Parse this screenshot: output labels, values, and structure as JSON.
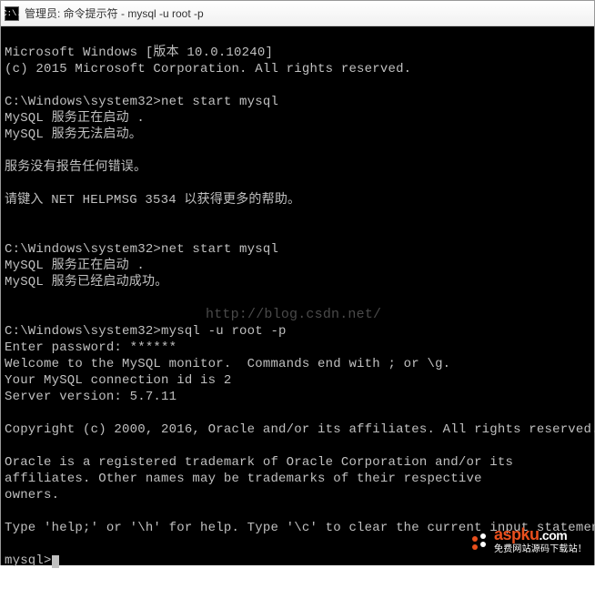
{
  "titlebar": {
    "icon_label": "C:\\.",
    "title": "管理员: 命令提示符 - mysql  -u root -p"
  },
  "terminal": {
    "l01": "Microsoft Windows [版本 10.0.10240]",
    "l02": "(c) 2015 Microsoft Corporation. All rights reserved.",
    "l03": "",
    "l04": "C:\\Windows\\system32>net start mysql",
    "l05": "MySQL 服务正在启动 .",
    "l06": "MySQL 服务无法启动。",
    "l07": "",
    "l08": "服务没有报告任何错误。",
    "l09": "",
    "l10": "请键入 NET HELPMSG 3534 以获得更多的帮助。",
    "l11": "",
    "l12": "",
    "l13": "C:\\Windows\\system32>net start mysql",
    "l14": "MySQL 服务正在启动 .",
    "l15": "MySQL 服务已经启动成功。",
    "l16": "",
    "l17": "",
    "l18": "C:\\Windows\\system32>mysql -u root -p",
    "l19": "Enter password: ******",
    "l20": "Welcome to the MySQL monitor.  Commands end with ; or \\g.",
    "l21": "Your MySQL connection id is 2",
    "l22": "Server version: 5.7.11",
    "l23": "",
    "l24": "Copyright (c) 2000, 2016, Oracle and/or its affiliates. All rights reserved.",
    "l25": "",
    "l26": "Oracle is a registered trademark of Oracle Corporation and/or its",
    "l27": "affiliates. Other names may be trademarks of their respective",
    "l28": "owners.",
    "l29": "",
    "l30": "Type 'help;' or '\\h' for help. Type '\\c' to clear the current input statement.",
    "l31": "",
    "prompt": "mysql>"
  },
  "watermarks": {
    "url": "http://blog.csdn.net/",
    "brand_main": "aspku",
    "brand_suffix": ".com",
    "brand_sub": "免费网站源码下载站！"
  }
}
